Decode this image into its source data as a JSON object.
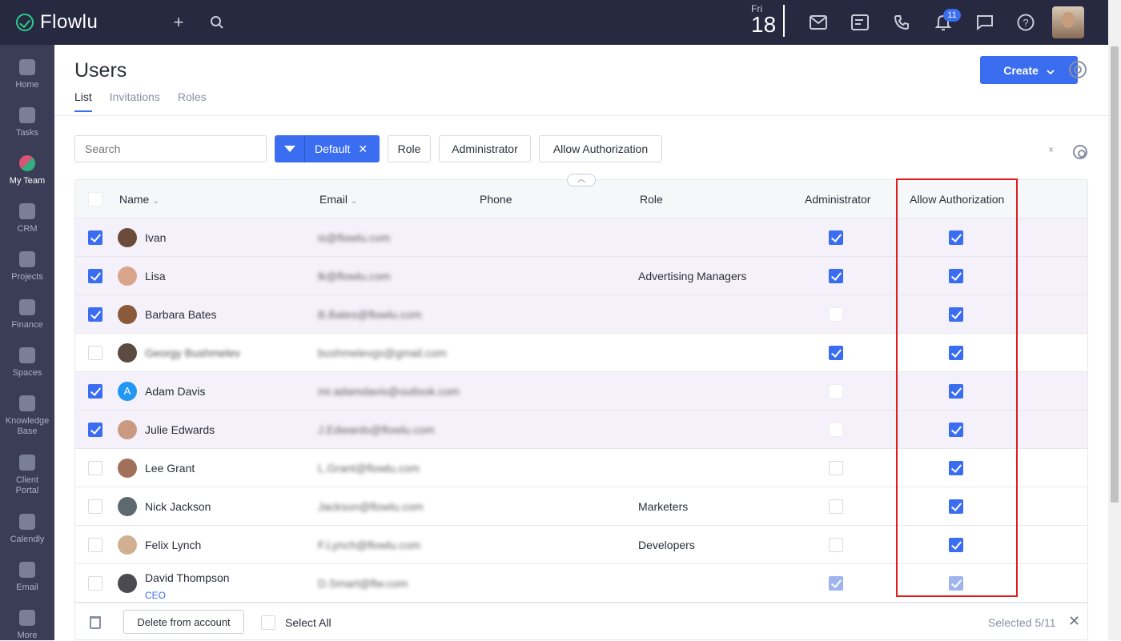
{
  "app": {
    "name": "Flowlu"
  },
  "topbar": {
    "date_dow": "Fri",
    "date_day": "18",
    "notifications_count": "11",
    "icons": [
      "plus-icon",
      "search-icon",
      "mail-icon",
      "notes-icon",
      "phone-icon",
      "bell-icon",
      "chat-icon",
      "help-icon"
    ]
  },
  "sidebar": {
    "items": [
      {
        "label": "Home"
      },
      {
        "label": "Tasks"
      },
      {
        "label": "My Team",
        "active": true
      },
      {
        "label": "CRM"
      },
      {
        "label": "Projects"
      },
      {
        "label": "Finance"
      },
      {
        "label": "Spaces"
      },
      {
        "label": "Knowledge Base"
      },
      {
        "label": "Client Portal"
      },
      {
        "label": "Calendly"
      },
      {
        "label": "Email"
      },
      {
        "label": "More"
      }
    ]
  },
  "page": {
    "title": "Users",
    "tabs": [
      "List",
      "Invitations",
      "Roles"
    ],
    "create_label": "Create"
  },
  "filters": {
    "search_placeholder": "Search",
    "active_filter": "Default",
    "buttons": [
      "Role",
      "Administrator",
      "Allow Authorization"
    ]
  },
  "table": {
    "headers": {
      "name": "Name",
      "email": "Email",
      "phone": "Phone",
      "role": "Role",
      "administrator": "Administrator",
      "allow_authorization": "Allow Authorization"
    },
    "rows": [
      {
        "name": "Ivan",
        "email": "is@flowlu.com",
        "role": "",
        "selected": true,
        "admin": "on",
        "auth": "on"
      },
      {
        "name": "Lisa",
        "email": "lk@flowlu.com",
        "role": "Advertising Managers",
        "selected": true,
        "admin": "on",
        "auth": "on"
      },
      {
        "name": "Barbara Bates",
        "email": "B.Bates@flowlu.com",
        "role": "",
        "selected": true,
        "admin": "faint",
        "auth": "on"
      },
      {
        "name": "Georgy Bushmelev",
        "email": "bushmelevgs@gmail.com",
        "role": "",
        "selected": false,
        "admin": "on",
        "auth": "on",
        "blur_name": true
      },
      {
        "name": "Adam Davis",
        "email": "mr.adamdavis@outlook.com",
        "role": "",
        "selected": true,
        "admin": "faint",
        "auth": "on",
        "letter": "A"
      },
      {
        "name": "Julie Edwards",
        "email": "J.Edwards@flowlu.com",
        "role": "",
        "selected": true,
        "admin": "faint",
        "auth": "on"
      },
      {
        "name": "Lee Grant",
        "email": "L.Grant@flowlu.com",
        "role": "",
        "selected": false,
        "admin": "off",
        "auth": "on"
      },
      {
        "name": "Nick Jackson",
        "email": "Jackson@flowlu.com",
        "role": "Marketers",
        "selected": false,
        "admin": "off",
        "auth": "on"
      },
      {
        "name": "Felix Lynch",
        "email": "F.Lynch@flowlu.com",
        "role": "Developers",
        "selected": false,
        "admin": "off",
        "auth": "on"
      },
      {
        "name": "David Thompson",
        "subtitle": "CEO",
        "email": "D.Smart@flw.com",
        "role": "",
        "selected": false,
        "admin": "dim",
        "auth": "dim"
      }
    ]
  },
  "bottombar": {
    "delete_label": "Delete from account",
    "select_all_label": "Select All",
    "selected_text": "Selected 5/11"
  },
  "colors": {
    "accent": "#3b6df0",
    "topbar": "#262940",
    "sidebar": "#3a3d55",
    "highlight": "#e01e1e"
  }
}
